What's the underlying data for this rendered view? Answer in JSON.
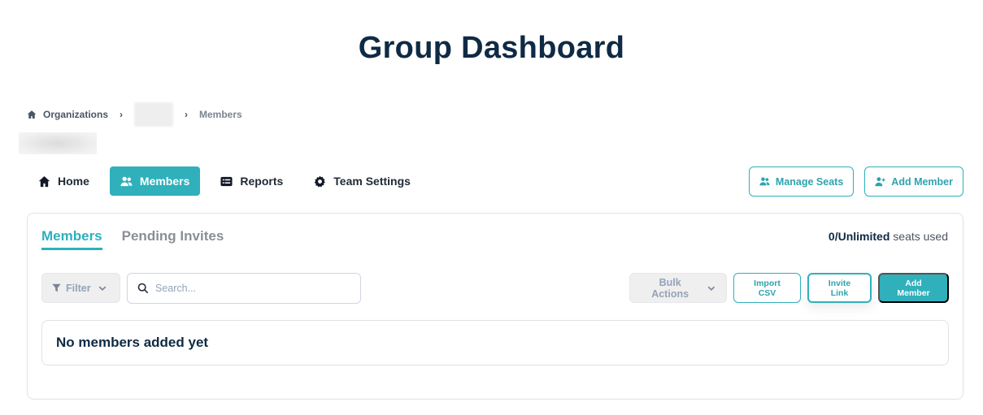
{
  "page": {
    "title": "Group Dashboard"
  },
  "breadcrumb": {
    "items": [
      {
        "label": "Organizations",
        "icon": "home-icon"
      },
      {
        "label": "",
        "redacted": true
      },
      {
        "label": "Members"
      }
    ]
  },
  "nav": {
    "items": [
      {
        "label": "Home",
        "icon": "home-icon",
        "active": false
      },
      {
        "label": "Members",
        "icon": "users-icon",
        "active": true
      },
      {
        "label": "Reports",
        "icon": "list-icon",
        "active": false
      },
      {
        "label": "Team Settings",
        "icon": "gear-icon",
        "active": false
      }
    ],
    "actions": [
      {
        "label": "Manage Seats",
        "icon": "users-icon"
      },
      {
        "label": "Add Member",
        "icon": "user-plus-icon"
      }
    ]
  },
  "card": {
    "tabs": [
      {
        "label": "Members",
        "active": true
      },
      {
        "label": "Pending Invites",
        "active": false
      }
    ],
    "seats": {
      "count": "0/Unlimited",
      "suffix": "seats used"
    },
    "filter_label": "Filter",
    "search": {
      "placeholder": "Search...",
      "value": ""
    },
    "bulk_actions_label": "Bulk Actions",
    "import_csv_label": "Import CSV",
    "invite_link_label": "Invite Link",
    "add_member_label": "Add Member",
    "empty_message": "No members added yet"
  },
  "colors": {
    "accent": "#2fb0bb",
    "heading": "#0f2a44"
  }
}
